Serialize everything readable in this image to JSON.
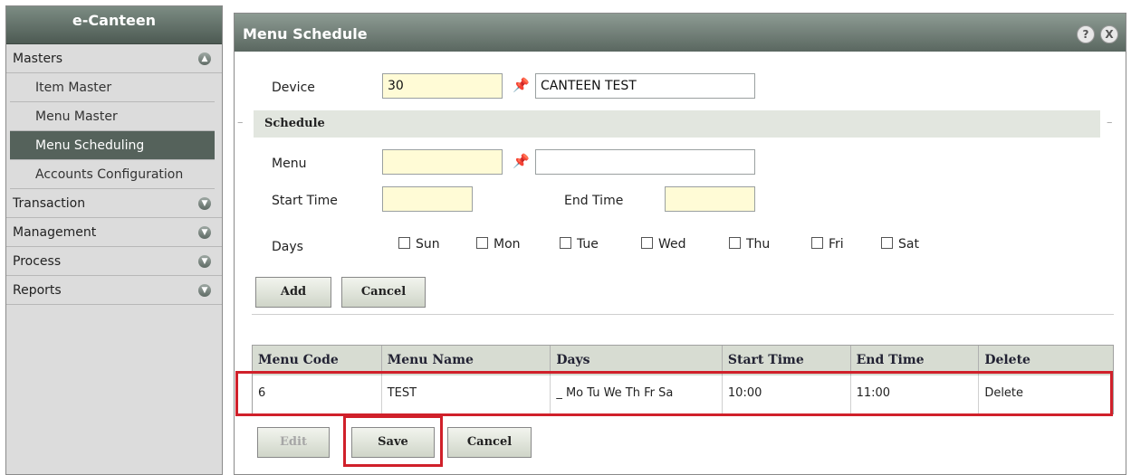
{
  "app": {
    "title": "e-Canteen"
  },
  "sidebar": {
    "sections": [
      {
        "label": "Masters",
        "expanded": true,
        "items": [
          "Item Master",
          "Menu Master",
          "Menu Scheduling",
          "Accounts Configuration"
        ],
        "active": "Menu Scheduling"
      },
      {
        "label": "Transaction",
        "expanded": false
      },
      {
        "label": "Management",
        "expanded": false
      },
      {
        "label": "Process",
        "expanded": false
      },
      {
        "label": "Reports",
        "expanded": false
      }
    ]
  },
  "panel": {
    "title": "Menu Schedule",
    "help_label": "?",
    "close_label": "X"
  },
  "form": {
    "device_label": "Device",
    "device_code": "30",
    "device_name": "CANTEEN TEST",
    "schedule_label": "Schedule",
    "menu_label": "Menu",
    "menu_code": "",
    "menu_name": "",
    "start_time_label": "Start Time",
    "start_time": "",
    "end_time_label": "End Time",
    "end_time": "",
    "days_label": "Days",
    "days": [
      "Sun",
      "Mon",
      "Tue",
      "Wed",
      "Thu",
      "Fri",
      "Sat"
    ],
    "add_label": "Add",
    "cancel_label": "Cancel"
  },
  "grid": {
    "columns": [
      "Menu Code",
      "Menu Name",
      "Days",
      "Start Time",
      "End Time",
      "Delete"
    ],
    "rows": [
      [
        "6",
        "TEST",
        "_ Mo Tu We Th Fr Sa",
        "10:00",
        "11:00",
        "Delete"
      ]
    ]
  },
  "footer": {
    "edit_label": "Edit",
    "save_label": "Save",
    "cancel_label": "Cancel"
  },
  "colors": {
    "highlight": "#d0202a",
    "required_field": "#fffbd6",
    "active_nav": "#55625b"
  }
}
